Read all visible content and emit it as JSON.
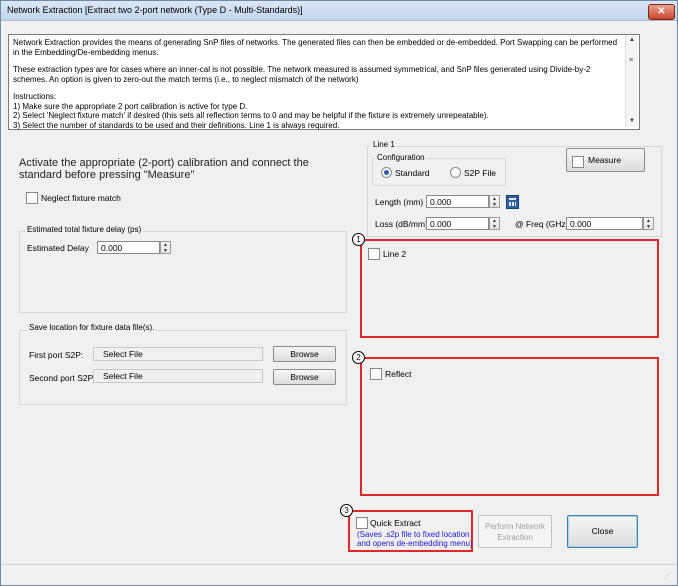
{
  "window": {
    "title": "Network Extraction [Extract two 2-port network (Type D - Multi-Standards)]",
    "close_glyph": "✕"
  },
  "info": {
    "p1": "Network Extraction provides the means of generating SnP files of networks. The generated files can then be embedded or de-embedded. Port Swapping can be performed in the Embedding/De-embedding menus.",
    "p2": "These extraction types are for cases where an inner-cal is not possible. The network measured is assumed symmetrical, and SnP files generated using Divide-by-2 schemes. An option is given to zero-out the match terms (i.e., to neglect mismatch of the network)",
    "p3_line1": "Instructions:",
    "p3_line2": "1) Make sure the appropriate 2 port calibration is active for type D.",
    "p3_line3": "2) Select 'Neglect fixture match' if desired (this sets all reflection terms to 0 and may be helpful if the fixture is extremely unrepeatable).",
    "p3_line4": "3) Select the number of standards to be used and their definitions. Line 1 is always required."
  },
  "left": {
    "heading": "Activate the appropriate (2-port) calibration and connect the standard before pressing \"Measure\"",
    "neglect_label": "Neglect fixture match",
    "delay_group": "Estimated total fixture delay (ps)",
    "delay_label": "Estimated Delay",
    "delay_value": "0.000",
    "save_group": "Save location for fixture data file(s).",
    "first_port_label": "First port S2P:",
    "first_port_value": "Select File",
    "second_port_label": "Second port S2P:",
    "second_port_value": "Select File",
    "browse_label": "Browse"
  },
  "line1": {
    "group": "Line 1",
    "config_label": "Configuration",
    "standard_label": "Standard",
    "s2p_label": "S2P File",
    "measure_label": "Measure",
    "length_label": "Length (mm)",
    "length_value": "0.000",
    "loss_label": "Loss (dB/mm)",
    "loss_value": "0.000",
    "freq_label": "@ Freq (GHz)",
    "freq_value": "0.000"
  },
  "line2": {
    "marker": "1",
    "label": "Line 2"
  },
  "reflect": {
    "marker": "2",
    "label": "Reflect"
  },
  "quick": {
    "marker": "3",
    "label": "Quick Extract",
    "note1": "(Saves .s2p file to fixed location",
    "note2": "and opens de-embedding menu)",
    "note_color": "#1a1ad6"
  },
  "actions": {
    "perform_line1": "Perform Network",
    "perform_line2": "Extraction",
    "close_label": "Close"
  },
  "colors": {
    "highlight": "#e2262a",
    "focus_border": "#3c7fb1"
  }
}
